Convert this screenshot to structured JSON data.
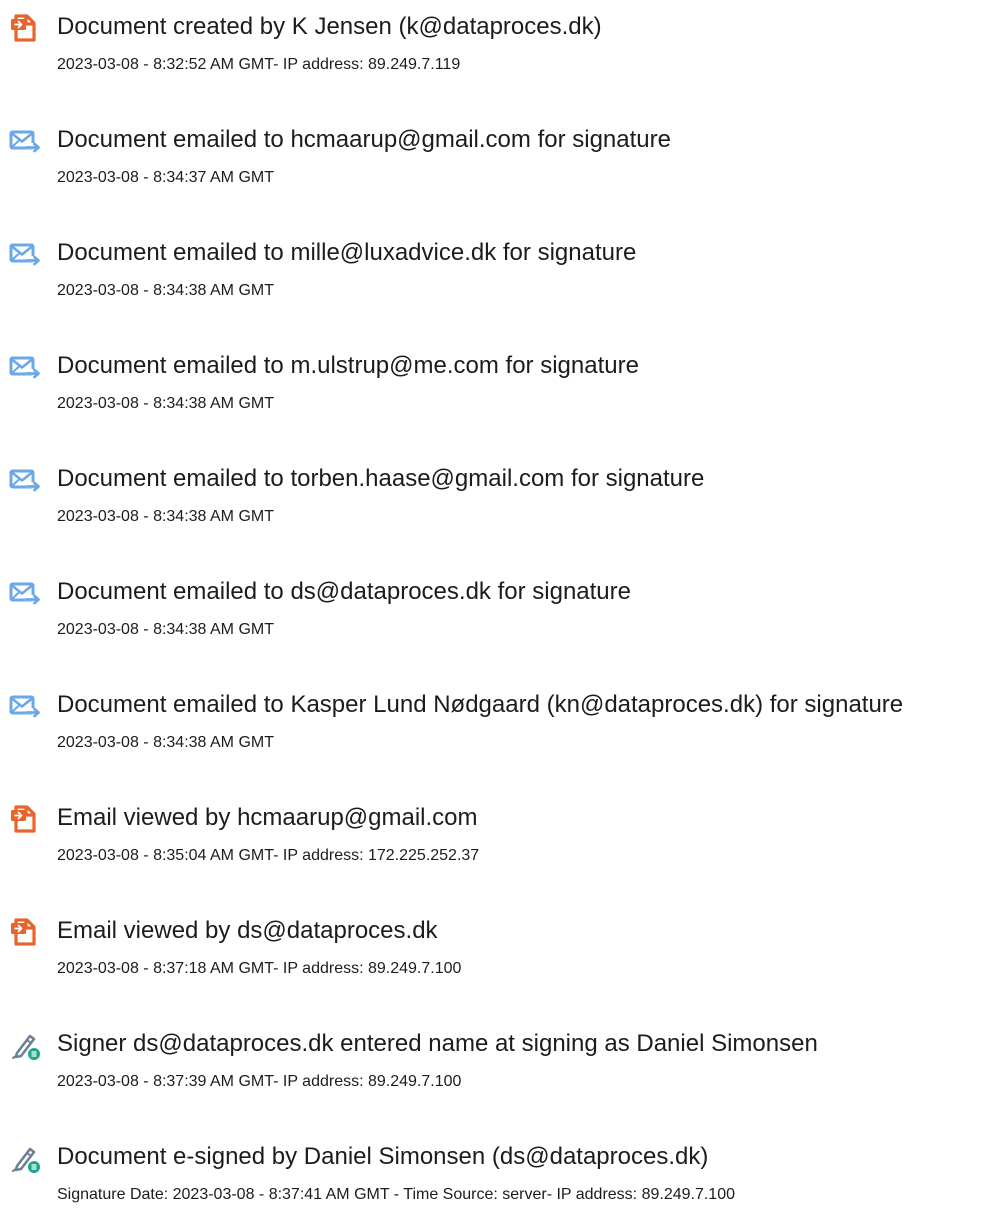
{
  "colors": {
    "created_icon": "#e8642c",
    "email_icon": "#6aa8e8",
    "sign_icon": "#6f7f97",
    "sign_badge": "#1fa68a"
  },
  "events": [
    {
      "icon": "document-created-icon",
      "title": "Document created by K Jensen (k@dataproces.dk)",
      "detail": "2023-03-08 - 8:32:52 AM GMT- IP address: 89.249.7.119"
    },
    {
      "icon": "email-sent-icon",
      "title": "Document emailed to hcmaarup@gmail.com for signature",
      "detail": "2023-03-08 - 8:34:37 AM GMT"
    },
    {
      "icon": "email-sent-icon",
      "title": "Document emailed to mille@luxadvice.dk for signature",
      "detail": "2023-03-08 - 8:34:38 AM GMT"
    },
    {
      "icon": "email-sent-icon",
      "title": "Document emailed to m.ulstrup@me.com for signature",
      "detail": "2023-03-08 - 8:34:38 AM GMT"
    },
    {
      "icon": "email-sent-icon",
      "title": "Document emailed to torben.haase@gmail.com for signature",
      "detail": "2023-03-08 - 8:34:38 AM GMT"
    },
    {
      "icon": "email-sent-icon",
      "title": "Document emailed to ds@dataproces.dk for signature",
      "detail": "2023-03-08 - 8:34:38 AM GMT"
    },
    {
      "icon": "email-sent-icon",
      "title": "Document emailed to Kasper Lund Nødgaard (kn@dataproces.dk) for signature",
      "detail": "2023-03-08 - 8:34:38 AM GMT"
    },
    {
      "icon": "document-viewed-icon",
      "title": "Email viewed by hcmaarup@gmail.com",
      "detail": "2023-03-08 - 8:35:04 AM GMT- IP address: 172.225.252.37"
    },
    {
      "icon": "document-viewed-icon",
      "title": "Email viewed by ds@dataproces.dk",
      "detail": "2023-03-08 - 8:37:18 AM GMT- IP address: 89.249.7.100"
    },
    {
      "icon": "signer-pen-icon",
      "title": "Signer ds@dataproces.dk entered name at signing as Daniel Simonsen",
      "detail": "2023-03-08 - 8:37:39 AM GMT- IP address: 89.249.7.100"
    },
    {
      "icon": "signer-pen-icon",
      "title": "Document e-signed by Daniel Simonsen (ds@dataproces.dk)",
      "detail": "Signature Date: 2023-03-08 - 8:37:41 AM GMT - Time Source: server- IP address: 89.249.7.100"
    }
  ]
}
